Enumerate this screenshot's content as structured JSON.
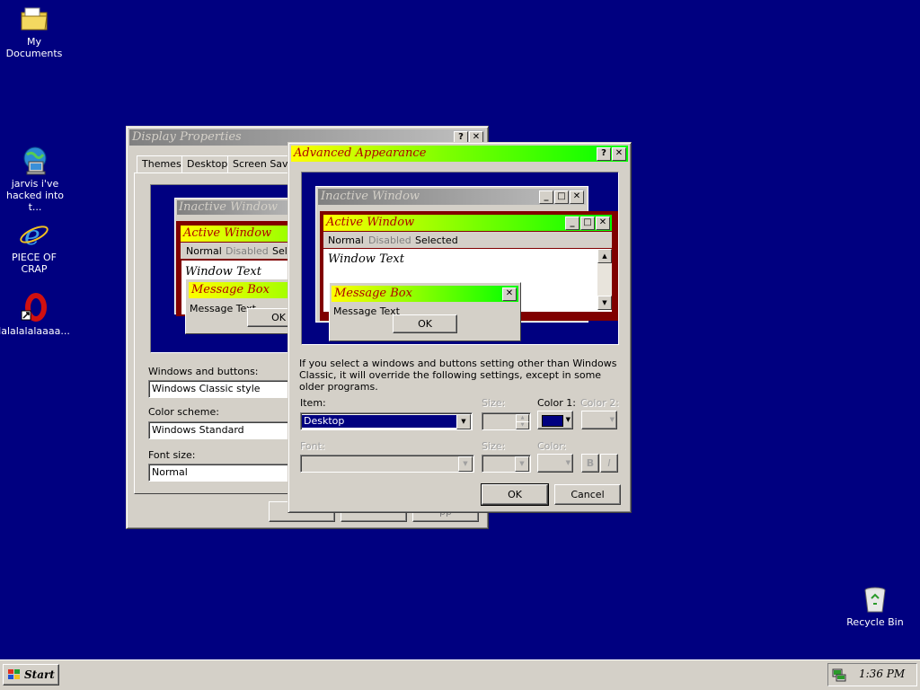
{
  "desktop": {
    "icons": [
      {
        "label": "My Documents"
      },
      {
        "label": "jarvis i've hacked into t..."
      },
      {
        "label": "PIECE OF CRAP"
      },
      {
        "label": "lalalalalaaaa..."
      },
      {
        "label": "Recycle Bin"
      }
    ]
  },
  "display_properties": {
    "title": "Display Properties",
    "tabs": [
      "Themes",
      "Desktop",
      "Screen Save"
    ],
    "preview": {
      "inactive_title": "Inactive Window",
      "active_title": "Active Window",
      "menu": [
        "Normal",
        "Disabled",
        "Sele"
      ],
      "window_text": "Window Text",
      "msgbox_title": "Message Box",
      "msgbox_text": "Message Text",
      "msgbox_ok": "OK"
    },
    "windows_buttons_label": "Windows and buttons:",
    "windows_buttons_value": "Windows Classic style",
    "color_scheme_label": "Color scheme:",
    "color_scheme_value": "Windows Standard",
    "font_size_label": "Font size:",
    "font_size_value": "Normal",
    "bottom_button_3": "pp"
  },
  "advanced": {
    "title": "Advanced Appearance",
    "preview": {
      "inactive_title": "Inactive Window",
      "active_title": "Active Window",
      "menu": [
        "Normal",
        "Disabled",
        "Selected"
      ],
      "window_text": "Window Text",
      "msgbox_title": "Message Box",
      "msgbox_text": "Message Text",
      "msgbox_ok": "OK"
    },
    "note": "If you select a windows and buttons setting other than Windows Classic, it will override the following settings, except in some older programs.",
    "item_label": "Item:",
    "item_value": "Desktop",
    "size_label": "Size:",
    "color1_label": "Color 1:",
    "color2_label": "Color 2:",
    "font_label": "Font:",
    "font_size_label": "Size:",
    "font_color_label": "Color:",
    "bold_label": "B",
    "italic_label": "I",
    "ok": "OK",
    "cancel": "Cancel",
    "color1_swatch": "#000080"
  },
  "taskbar": {
    "start": "Start",
    "clock": "1:36 PM"
  },
  "colors": {
    "desktop": "#000080",
    "face": "#d4d0c8",
    "active_title_text": "#b00000",
    "preview_frame": "#800000"
  }
}
